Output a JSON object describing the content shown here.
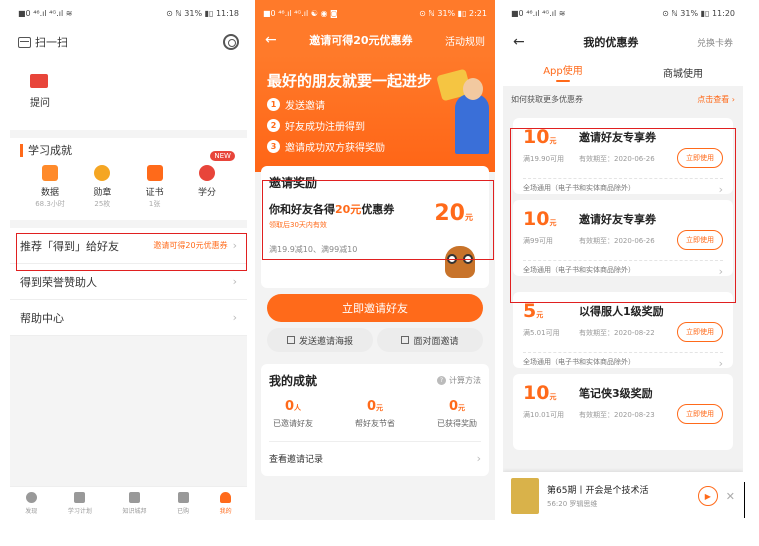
{
  "s1": {
    "status_left": "■0 ⁴⁶.ıl ⁴ᴳ.ıl ≋",
    "status_right": "⊙ ℕ 31% ▮▯ 11:18",
    "scan_label": "扫一扫",
    "ticket_label": "提问",
    "achv_title": "学习成就",
    "new_badge": "NEW",
    "achievements": [
      {
        "name": "数据",
        "sub": "68.3小时"
      },
      {
        "name": "勋章",
        "sub": "25枚"
      },
      {
        "name": "证书",
        "sub": "1张"
      },
      {
        "name": "学分",
        "sub": ""
      }
    ],
    "menu": [
      {
        "label": "推荐「得到」给好友",
        "right": "邀请可得20元优惠券"
      },
      {
        "label": "得到荣誉赞助人",
        "right": ""
      },
      {
        "label": "帮助中心",
        "right": ""
      }
    ],
    "tabs": [
      "发现",
      "学习计划",
      "知识城邦",
      "已购",
      "我的"
    ]
  },
  "s2": {
    "status_left": "■0 ⁴⁶.ıl ⁴ᴳ.ıl ☯ ◉ ◙",
    "status_right": "⊙ ℕ 31% ▮▯ 2:21",
    "title": "邀请可得20元优惠券",
    "rule": "活动规则",
    "banner_title": "最好的朋友就要一起进步",
    "steps": [
      "发送邀请",
      "好友成功注册得到",
      "邀请成功双方获得奖励"
    ],
    "reward_title": "邀请奖励",
    "reward_text_a": "你和好友各得",
    "reward_text_hl": "20元",
    "reward_text_b": "优惠券",
    "reward_sub": "领取后30天内有效",
    "reward_amt": "20",
    "reward_unit": "元",
    "reward_note": "满19.9减10、满99减10",
    "invite_btn": "立即邀请好友",
    "poster_btn": "发送邀请海报",
    "face_btn": "面对面邀请",
    "stats_title": "我的成就",
    "calc": "计算方法",
    "stats": [
      {
        "val": "0",
        "unit": "人",
        "label": "已邀请好友"
      },
      {
        "val": "0",
        "unit": "元",
        "label": "帮好友节省"
      },
      {
        "val": "0",
        "unit": "元",
        "label": "已获得奖励"
      }
    ],
    "records": "查看邀请记录"
  },
  "s3": {
    "status_left": "■0 ⁴⁶.ıl ⁴ᴳ.ıl ≋",
    "status_right": "⊙ ℕ 31% ▮▯ 11:20",
    "title": "我的优惠券",
    "exchange": "兑换卡券",
    "tabs": [
      "App使用",
      "商城使用"
    ],
    "howto": "如何获取更多优惠券",
    "howto_link": "点击查看 ›",
    "coupons": [
      {
        "amt": "10",
        "unit": "元",
        "name": "邀请好友专享券",
        "min": "满19.90可用",
        "exp": "有效期至：2020-06-26",
        "btn": "立即使用",
        "scope": "全场通用（电子书和实体商品除外）"
      },
      {
        "amt": "10",
        "unit": "元",
        "name": "邀请好友专享券",
        "min": "满99可用",
        "exp": "有效期至：2020-06-26",
        "btn": "立即使用",
        "scope": "全场通用（电子书和实体商品除外）"
      },
      {
        "amt": "5",
        "unit": "元",
        "name": "以得服人1级奖励",
        "min": "满5.01可用",
        "exp": "有效期至：2020-08-22",
        "btn": "立即使用",
        "scope": "全场通用（电子书和实体商品除外）"
      },
      {
        "amt": "10",
        "unit": "元",
        "name": "笔记侠3级奖励",
        "min": "满10.01可用",
        "exp": "有效期至：2020-08-23",
        "btn": "立即使用",
        "scope": ""
      }
    ],
    "player_title": "第65期丨开会是个技术活",
    "player_sub": "56:20 罗辑思维"
  }
}
